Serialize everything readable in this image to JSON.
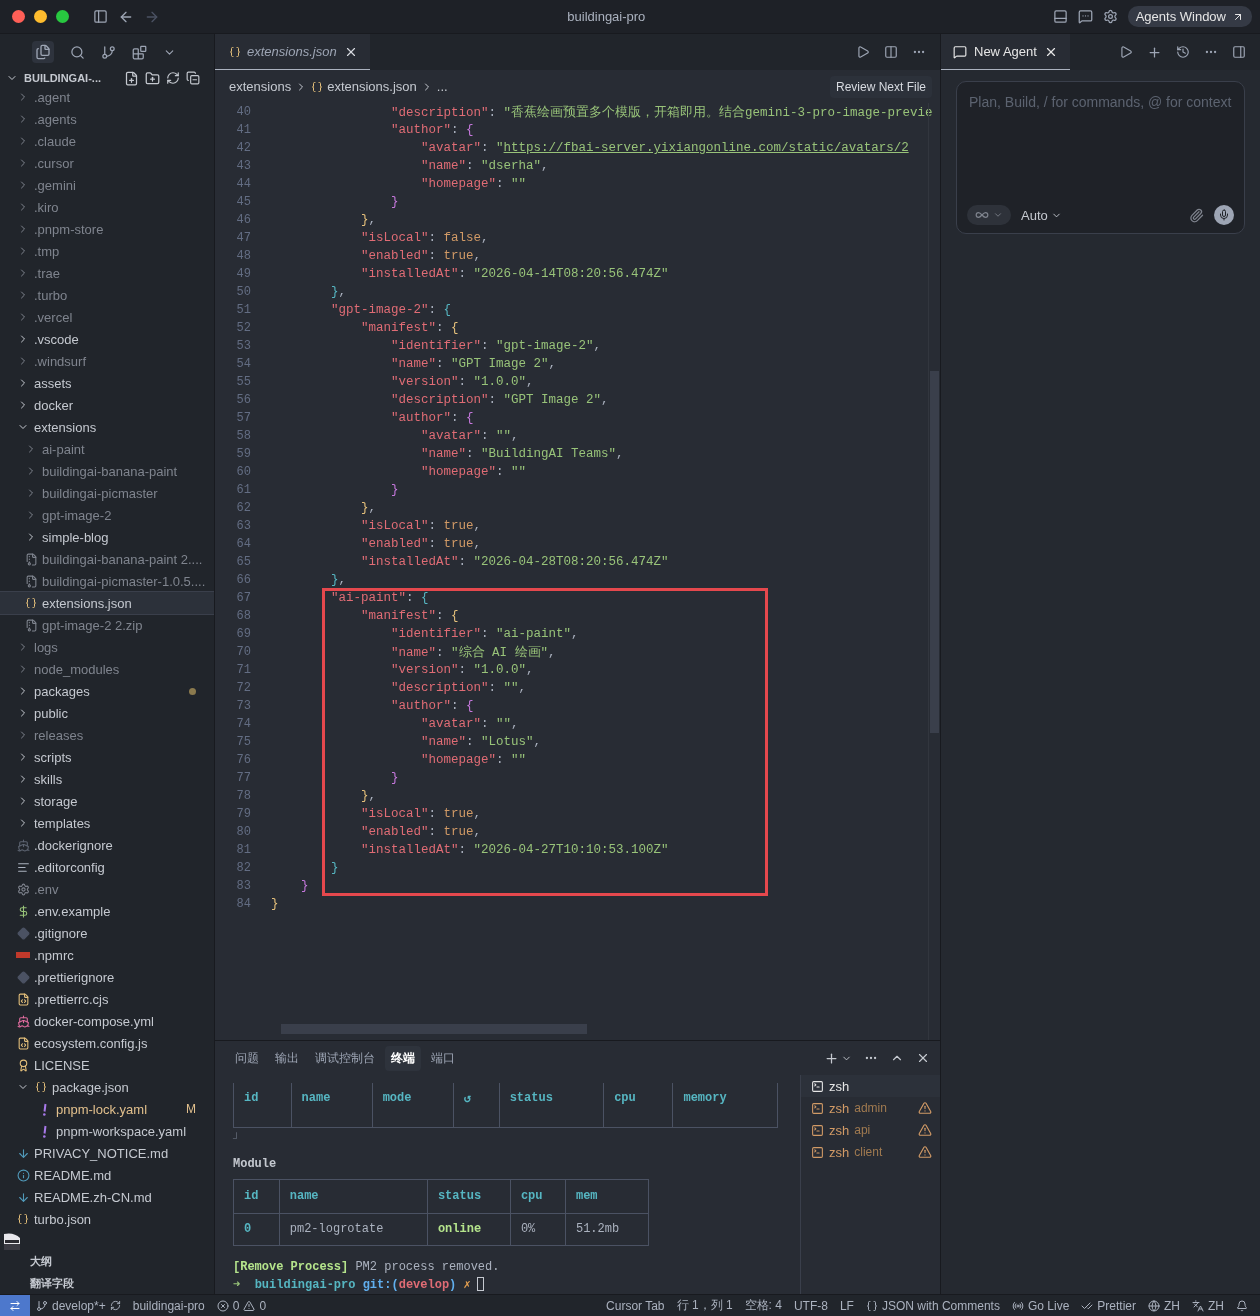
{
  "window": {
    "title": "buildingai-pro",
    "agents_button": "Agents Window"
  },
  "explorer": {
    "title": "BUILDINGAI-...",
    "tree": [
      {
        "name": ".agent",
        "kind": "folder",
        "expanded": false,
        "selected": false,
        "dimmed": true,
        "modified": false
      },
      {
        "name": ".agents",
        "kind": "folder",
        "expanded": false,
        "selected": false,
        "dimmed": true,
        "modified": false
      },
      {
        "name": ".claude",
        "kind": "folder",
        "expanded": false,
        "selected": false,
        "dimmed": true,
        "modified": false
      },
      {
        "name": ".cursor",
        "kind": "folder",
        "expanded": false,
        "selected": false,
        "dimmed": true,
        "modified": false
      },
      {
        "name": ".gemini",
        "kind": "folder",
        "expanded": false,
        "selected": false,
        "dimmed": true,
        "modified": false
      },
      {
        "name": ".kiro",
        "kind": "folder",
        "expanded": false,
        "selected": false,
        "dimmed": true,
        "modified": false
      },
      {
        "name": ".pnpm-store",
        "kind": "folder",
        "expanded": false,
        "selected": false,
        "dimmed": true,
        "modified": false
      },
      {
        "name": ".tmp",
        "kind": "folder",
        "expanded": false,
        "selected": false,
        "dimmed": true,
        "modified": false
      },
      {
        "name": ".trae",
        "kind": "folder",
        "expanded": false,
        "selected": false,
        "dimmed": true,
        "modified": false
      },
      {
        "name": ".turbo",
        "kind": "folder",
        "expanded": false,
        "selected": false,
        "dimmed": true,
        "modified": false
      },
      {
        "name": ".vercel",
        "kind": "folder",
        "expanded": false,
        "selected": false,
        "dimmed": true,
        "modified": false
      },
      {
        "name": ".vscode",
        "kind": "folder",
        "expanded": false,
        "selected": false,
        "dimmed": false,
        "modified": false
      },
      {
        "name": ".windsurf",
        "kind": "folder",
        "expanded": false,
        "selected": false,
        "dimmed": true,
        "modified": false
      },
      {
        "name": "assets",
        "kind": "folder",
        "expanded": false,
        "selected": false,
        "dimmed": false,
        "modified": false
      },
      {
        "name": "docker",
        "kind": "folder",
        "expanded": false,
        "selected": false,
        "dimmed": false,
        "modified": false
      },
      {
        "name": "extensions",
        "kind": "folder",
        "expanded": true,
        "selected": false,
        "dimmed": false,
        "modified": false,
        "children": [
          {
            "name": "ai-paint",
            "kind": "folder",
            "expanded": false,
            "selected": false,
            "dimmed": true,
            "modified": false
          },
          {
            "name": "buildingai-banana-paint",
            "kind": "folder",
            "expanded": false,
            "selected": false,
            "dimmed": true,
            "modified": false
          },
          {
            "name": "buildingai-picmaster",
            "kind": "folder",
            "expanded": false,
            "selected": false,
            "dimmed": true,
            "modified": false
          },
          {
            "name": "gpt-image-2",
            "kind": "folder",
            "expanded": false,
            "selected": false,
            "dimmed": true,
            "modified": false
          },
          {
            "name": "simple-blog",
            "kind": "folder",
            "expanded": false,
            "selected": false,
            "dimmed": false,
            "modified": false
          },
          {
            "name": "buildingai-banana-paint 2....",
            "kind": "zip",
            "selected": false,
            "dimmed": true,
            "modified": false
          },
          {
            "name": "buildingai-picmaster-1.0.5....",
            "kind": "zip",
            "selected": false,
            "dimmed": true,
            "modified": false
          },
          {
            "name": "extensions.json",
            "kind": "json",
            "selected": true,
            "dimmed": false,
            "modified": false
          },
          {
            "name": "gpt-image-2 2.zip",
            "kind": "zip",
            "selected": false,
            "dimmed": true,
            "modified": false
          }
        ]
      },
      {
        "name": "logs",
        "kind": "folder",
        "expanded": false,
        "selected": false,
        "dimmed": true,
        "modified": false
      },
      {
        "name": "node_modules",
        "kind": "folder",
        "expanded": false,
        "selected": false,
        "dimmed": true,
        "modified": false
      },
      {
        "name": "packages",
        "kind": "folder",
        "expanded": false,
        "selected": false,
        "dimmed": false,
        "modified": true
      },
      {
        "name": "public",
        "kind": "folder",
        "expanded": false,
        "selected": false,
        "dimmed": false,
        "modified": false
      },
      {
        "name": "releases",
        "kind": "folder",
        "expanded": false,
        "selected": false,
        "dimmed": true,
        "modified": false
      },
      {
        "name": "scripts",
        "kind": "folder",
        "expanded": false,
        "selected": false,
        "dimmed": false,
        "modified": false
      },
      {
        "name": "skills",
        "kind": "folder",
        "expanded": false,
        "selected": false,
        "dimmed": false,
        "modified": false
      },
      {
        "name": "storage",
        "kind": "folder",
        "expanded": false,
        "selected": false,
        "dimmed": false,
        "modified": false
      },
      {
        "name": "templates",
        "kind": "folder",
        "expanded": false,
        "selected": false,
        "dimmed": false,
        "modified": false
      },
      {
        "name": ".dockerignore",
        "kind": "docker",
        "selected": false,
        "dimmed": false,
        "modified": false
      },
      {
        "name": ".editorconfig",
        "kind": "lines",
        "selected": false,
        "dimmed": false,
        "modified": false
      },
      {
        "name": ".env",
        "kind": "gear",
        "selected": false,
        "dimmed": true,
        "modified": false
      },
      {
        "name": ".env.example",
        "kind": "dollar",
        "selected": false,
        "dimmed": false,
        "modified": false
      },
      {
        "name": ".gitignore",
        "kind": "git",
        "selected": false,
        "dimmed": false,
        "modified": false
      },
      {
        "name": ".npmrc",
        "kind": "npm",
        "selected": false,
        "dimmed": false,
        "modified": false
      },
      {
        "name": ".prettierignore",
        "kind": "git",
        "selected": false,
        "dimmed": false,
        "modified": false
      },
      {
        "name": ".prettierrc.cjs",
        "kind": "js",
        "selected": false,
        "dimmed": false,
        "modified": false
      },
      {
        "name": "docker-compose.yml",
        "kind": "whale",
        "selected": false,
        "dimmed": false,
        "modified": false
      },
      {
        "name": "ecosystem.config.js",
        "kind": "js",
        "selected": false,
        "dimmed": false,
        "modified": false
      },
      {
        "name": "LICENSE",
        "kind": "license",
        "selected": false,
        "dimmed": false,
        "modified": false
      },
      {
        "name": "package.json",
        "kind": "json",
        "expanded": true,
        "selected": false,
        "dimmed": false,
        "modified": false,
        "children": [
          {
            "name": "pnpm-lock.yaml",
            "kind": "yaml",
            "selected": false,
            "dimmed": false,
            "modified": true,
            "badge": "M"
          },
          {
            "name": "pnpm-workspace.yaml",
            "kind": "yaml",
            "selected": false,
            "dimmed": false,
            "modified": false
          }
        ]
      },
      {
        "name": "PRIVACY_NOTICE.md",
        "kind": "markdown",
        "selected": false,
        "dimmed": false,
        "modified": false
      },
      {
        "name": "README.md",
        "kind": "info",
        "selected": false,
        "dimmed": false,
        "modified": false
      },
      {
        "name": "README.zh-CN.md",
        "kind": "markdown",
        "selected": false,
        "dimmed": false,
        "modified": false
      },
      {
        "name": "turbo.json",
        "kind": "json",
        "selected": false,
        "dimmed": false,
        "modified": false
      }
    ],
    "sections": [
      "大纲",
      "翻译字段"
    ]
  },
  "editor": {
    "tab": {
      "label": "extensions.json",
      "preview": true
    },
    "breadcrumb": [
      "extensions",
      "extensions.json",
      "..."
    ],
    "review_button": "Review Next File",
    "lines": [
      {
        "no": "40",
        "tokens": [
          {
            "kind": "key",
            "text": "                \"description\""
          },
          {
            "kind": "punct",
            "text": ": "
          },
          {
            "kind": "str",
            "text": "\"香蕉绘画预置多个模版，开箱即用。结合gemini-3-pro-image-previe"
          }
        ]
      },
      {
        "no": "41",
        "tokens": [
          {
            "kind": "key",
            "text": "                \"author\""
          },
          {
            "kind": "punct",
            "text": ": "
          },
          {
            "kind": "brace",
            "text": "{",
            "color": "#c678dd"
          }
        ]
      },
      {
        "no": "42",
        "tokens": [
          {
            "kind": "key",
            "text": "                    \"avatar\""
          },
          {
            "kind": "punct",
            "text": ": "
          },
          {
            "kind": "str",
            "text": "\""
          },
          {
            "kind": "link",
            "text": "https://fbai-server.yixiangonline.com/static/avatars/2"
          }
        ]
      },
      {
        "no": "43",
        "tokens": [
          {
            "kind": "key",
            "text": "                    \"name\""
          },
          {
            "kind": "punct",
            "text": ": "
          },
          {
            "kind": "str",
            "text": "\"dserha\""
          },
          {
            "kind": "punct",
            "text": ","
          }
        ]
      },
      {
        "no": "44",
        "tokens": [
          {
            "kind": "key",
            "text": "                    \"homepage\""
          },
          {
            "kind": "punct",
            "text": ": "
          },
          {
            "kind": "str",
            "text": "\"\""
          }
        ]
      },
      {
        "no": "45",
        "tokens": [
          {
            "kind": "brace",
            "text": "                }",
            "color": "#c678dd"
          }
        ]
      },
      {
        "no": "46",
        "tokens": [
          {
            "kind": "brace",
            "text": "            }",
            "color": "#e5c07b"
          },
          {
            "kind": "punct",
            "text": ","
          }
        ]
      },
      {
        "no": "47",
        "tokens": [
          {
            "kind": "key",
            "text": "            \"isLocal\""
          },
          {
            "kind": "punct",
            "text": ": "
          },
          {
            "kind": "bool",
            "text": "false"
          },
          {
            "kind": "punct",
            "text": ","
          }
        ]
      },
      {
        "no": "48",
        "tokens": [
          {
            "kind": "key",
            "text": "            \"enabled\""
          },
          {
            "kind": "punct",
            "text": ": "
          },
          {
            "kind": "bool",
            "text": "true"
          },
          {
            "kind": "punct",
            "text": ","
          }
        ]
      },
      {
        "no": "49",
        "tokens": [
          {
            "kind": "key",
            "text": "            \"installedAt\""
          },
          {
            "kind": "punct",
            "text": ": "
          },
          {
            "kind": "str",
            "text": "\"2026-04-14T08:20:56.474Z\""
          }
        ]
      },
      {
        "no": "50",
        "tokens": [
          {
            "kind": "brace",
            "text": "        }",
            "color": "#56b6c2"
          },
          {
            "kind": "punct",
            "text": ","
          }
        ]
      },
      {
        "no": "51",
        "tokens": [
          {
            "kind": "key",
            "text": "        \"gpt-image-2\""
          },
          {
            "kind": "punct",
            "text": ": "
          },
          {
            "kind": "brace",
            "text": "{",
            "color": "#56b6c2"
          }
        ]
      },
      {
        "no": "52",
        "tokens": [
          {
            "kind": "key",
            "text": "            \"manifest\""
          },
          {
            "kind": "punct",
            "text": ": "
          },
          {
            "kind": "brace",
            "text": "{",
            "color": "#e5c07b"
          }
        ]
      },
      {
        "no": "53",
        "tokens": [
          {
            "kind": "key",
            "text": "                \"identifier\""
          },
          {
            "kind": "punct",
            "text": ": "
          },
          {
            "kind": "str",
            "text": "\"gpt-image-2\""
          },
          {
            "kind": "punct",
            "text": ","
          }
        ]
      },
      {
        "no": "54",
        "tokens": [
          {
            "kind": "key",
            "text": "                \"name\""
          },
          {
            "kind": "punct",
            "text": ": "
          },
          {
            "kind": "str",
            "text": "\"GPT Image 2\""
          },
          {
            "kind": "punct",
            "text": ","
          }
        ]
      },
      {
        "no": "55",
        "tokens": [
          {
            "kind": "key",
            "text": "                \"version\""
          },
          {
            "kind": "punct",
            "text": ": "
          },
          {
            "kind": "str",
            "text": "\"1.0.0\""
          },
          {
            "kind": "punct",
            "text": ","
          }
        ]
      },
      {
        "no": "56",
        "tokens": [
          {
            "kind": "key",
            "text": "                \"description\""
          },
          {
            "kind": "punct",
            "text": ": "
          },
          {
            "kind": "str",
            "text": "\"GPT Image 2\""
          },
          {
            "kind": "punct",
            "text": ","
          }
        ]
      },
      {
        "no": "57",
        "tokens": [
          {
            "kind": "key",
            "text": "                \"author\""
          },
          {
            "kind": "punct",
            "text": ": "
          },
          {
            "kind": "brace",
            "text": "{",
            "color": "#c678dd"
          }
        ]
      },
      {
        "no": "58",
        "tokens": [
          {
            "kind": "key",
            "text": "                    \"avatar\""
          },
          {
            "kind": "punct",
            "text": ": "
          },
          {
            "kind": "str",
            "text": "\"\""
          },
          {
            "kind": "punct",
            "text": ","
          }
        ]
      },
      {
        "no": "59",
        "tokens": [
          {
            "kind": "key",
            "text": "                    \"name\""
          },
          {
            "kind": "punct",
            "text": ": "
          },
          {
            "kind": "str",
            "text": "\"BuildingAI Teams\""
          },
          {
            "kind": "punct",
            "text": ","
          }
        ]
      },
      {
        "no": "60",
        "tokens": [
          {
            "kind": "key",
            "text": "                    \"homepage\""
          },
          {
            "kind": "punct",
            "text": ": "
          },
          {
            "kind": "str",
            "text": "\"\""
          }
        ]
      },
      {
        "no": "61",
        "tokens": [
          {
            "kind": "brace",
            "text": "                }",
            "color": "#c678dd"
          }
        ]
      },
      {
        "no": "62",
        "tokens": [
          {
            "kind": "brace",
            "text": "            }",
            "color": "#e5c07b"
          },
          {
            "kind": "punct",
            "text": ","
          }
        ]
      },
      {
        "no": "63",
        "tokens": [
          {
            "kind": "key",
            "text": "            \"isLocal\""
          },
          {
            "kind": "punct",
            "text": ": "
          },
          {
            "kind": "bool",
            "text": "true"
          },
          {
            "kind": "punct",
            "text": ","
          }
        ]
      },
      {
        "no": "64",
        "tokens": [
          {
            "kind": "key",
            "text": "            \"enabled\""
          },
          {
            "kind": "punct",
            "text": ": "
          },
          {
            "kind": "bool",
            "text": "true"
          },
          {
            "kind": "punct",
            "text": ","
          }
        ]
      },
      {
        "no": "65",
        "tokens": [
          {
            "kind": "key",
            "text": "            \"installedAt\""
          },
          {
            "kind": "punct",
            "text": ": "
          },
          {
            "kind": "str",
            "text": "\"2026-04-28T08:20:56.474Z\""
          }
        ]
      },
      {
        "no": "66",
        "tokens": [
          {
            "kind": "brace",
            "text": "        }",
            "color": "#56b6c2"
          },
          {
            "kind": "punct",
            "text": ","
          }
        ]
      }
    ],
    "framed_lines": [
      {
        "no": "67",
        "tokens": [
          {
            "kind": "key",
            "text": "        \"ai-paint\""
          },
          {
            "kind": "punct",
            "text": ": "
          },
          {
            "kind": "brace",
            "text": "{",
            "color": "#56b6c2"
          }
        ]
      },
      {
        "no": "68",
        "tokens": [
          {
            "kind": "key",
            "text": "            \"manifest\""
          },
          {
            "kind": "punct",
            "text": ": "
          },
          {
            "kind": "brace",
            "text": "{",
            "color": "#e5c07b"
          }
        ]
      },
      {
        "no": "69",
        "tokens": [
          {
            "kind": "key",
            "text": "                \"identifier\""
          },
          {
            "kind": "punct",
            "text": ": "
          },
          {
            "kind": "str",
            "text": "\"ai-paint\""
          },
          {
            "kind": "punct",
            "text": ","
          }
        ]
      },
      {
        "no": "70",
        "tokens": [
          {
            "kind": "key",
            "text": "                \"name\""
          },
          {
            "kind": "punct",
            "text": ": "
          },
          {
            "kind": "str",
            "text": "\"综合 AI 绘画\""
          },
          {
            "kind": "punct",
            "text": ","
          }
        ]
      },
      {
        "no": "71",
        "tokens": [
          {
            "kind": "key",
            "text": "                \"version\""
          },
          {
            "kind": "punct",
            "text": ": "
          },
          {
            "kind": "str",
            "text": "\"1.0.0\""
          },
          {
            "kind": "punct",
            "text": ","
          }
        ]
      },
      {
        "no": "72",
        "tokens": [
          {
            "kind": "key",
            "text": "                \"description\""
          },
          {
            "kind": "punct",
            "text": ": "
          },
          {
            "kind": "str",
            "text": "\"\""
          },
          {
            "kind": "punct",
            "text": ","
          }
        ]
      },
      {
        "no": "73",
        "tokens": [
          {
            "kind": "key",
            "text": "                \"author\""
          },
          {
            "kind": "punct",
            "text": ": "
          },
          {
            "kind": "brace",
            "text": "{",
            "color": "#c678dd"
          }
        ]
      },
      {
        "no": "74",
        "tokens": [
          {
            "kind": "key",
            "text": "                    \"avatar\""
          },
          {
            "kind": "punct",
            "text": ": "
          },
          {
            "kind": "str",
            "text": "\"\""
          },
          {
            "kind": "punct",
            "text": ","
          }
        ]
      },
      {
        "no": "75",
        "tokens": [
          {
            "kind": "key",
            "text": "                    \"name\""
          },
          {
            "kind": "punct",
            "text": ": "
          },
          {
            "kind": "str",
            "text": "\"Lotus\""
          },
          {
            "kind": "punct",
            "text": ","
          }
        ]
      },
      {
        "no": "76",
        "tokens": [
          {
            "kind": "key",
            "text": "                    \"homepage\""
          },
          {
            "kind": "punct",
            "text": ": "
          },
          {
            "kind": "str",
            "text": "\"\""
          }
        ]
      },
      {
        "no": "77",
        "tokens": [
          {
            "kind": "brace",
            "text": "                }",
            "color": "#c678dd"
          }
        ]
      },
      {
        "no": "78",
        "tokens": [
          {
            "kind": "brace",
            "text": "            }",
            "color": "#e5c07b"
          },
          {
            "kind": "punct",
            "text": ","
          }
        ]
      },
      {
        "no": "79",
        "tokens": [
          {
            "kind": "key",
            "text": "            \"isLocal\""
          },
          {
            "kind": "punct",
            "text": ": "
          },
          {
            "kind": "bool",
            "text": "true"
          },
          {
            "kind": "punct",
            "text": ","
          }
        ]
      },
      {
        "no": "80",
        "tokens": [
          {
            "kind": "key",
            "text": "            \"enabled\""
          },
          {
            "kind": "punct",
            "text": ": "
          },
          {
            "kind": "bool",
            "text": "true"
          },
          {
            "kind": "punct",
            "text": ","
          }
        ]
      },
      {
        "no": "81",
        "tokens": [
          {
            "kind": "key",
            "text": "            \"installedAt\""
          },
          {
            "kind": "punct",
            "text": ": "
          },
          {
            "kind": "str",
            "text": "\"2026-04-27T10:10:53.100Z\""
          }
        ]
      },
      {
        "no": "82",
        "tokens": [
          {
            "kind": "brace",
            "text": "        }",
            "color": "#56b6c2"
          }
        ]
      },
      {
        "no": "83",
        "tokens": [
          {
            "kind": "brace",
            "text": "    }",
            "color": "#c678dd"
          }
        ]
      }
    ],
    "lines_after": [
      {
        "no": "84",
        "tokens": [
          {
            "kind": "brace",
            "text": "}",
            "color": "#e5c07b"
          }
        ]
      }
    ]
  },
  "panel": {
    "tabs": [
      {
        "label": "问题",
        "selected": false
      },
      {
        "label": "输出",
        "selected": false
      },
      {
        "label": "调试控制台",
        "selected": false
      },
      {
        "label": "终端",
        "selected": true
      },
      {
        "label": "端口",
        "selected": false
      }
    ],
    "terminal": {
      "pm2_columns": [
        "id",
        "name",
        "mode",
        "↺",
        "status",
        "cpu",
        "memory"
      ],
      "corner": "┘",
      "module_title": "Module",
      "module_table": {
        "columns": [
          "id",
          "name",
          "status",
          "cpu",
          "mem"
        ],
        "rows": [
          [
            "0",
            "pm2-logrotate",
            "online",
            "0%",
            "51.2mb"
          ]
        ]
      },
      "log": {
        "tag": "[Remove Process]",
        "message": "PM2 process removed."
      },
      "prompt": {
        "arrow": "➜",
        "dir": "buildingai-pro",
        "git_open": "git:(",
        "branch": "develop",
        "git_close": ")",
        "dirty": "✗"
      }
    },
    "terminals": [
      {
        "name": "zsh",
        "selected": true,
        "warning": false
      },
      {
        "name": "zsh",
        "detail": "admin",
        "selected": false,
        "warning": true
      },
      {
        "name": "zsh",
        "detail": "api",
        "selected": false,
        "warning": true
      },
      {
        "name": "zsh",
        "detail": "client",
        "selected": false,
        "warning": true
      }
    ]
  },
  "agent": {
    "tab": "New Agent",
    "placeholder": "Plan, Build, / for commands, @ for context",
    "mode": "Auto"
  },
  "status_bar": {
    "branch": "develop*+",
    "project": "buildingai-pro",
    "errors": "0",
    "warnings": "0",
    "items": [
      {
        "kind": "text",
        "label": "Cursor Tab"
      },
      {
        "kind": "text",
        "label": "行 1，列 1"
      },
      {
        "kind": "text",
        "label": "空格: 4"
      },
      {
        "kind": "text",
        "label": "UTF-8"
      },
      {
        "kind": "text",
        "label": "LF"
      },
      {
        "kind": "language",
        "label": "JSON with Comments"
      },
      {
        "kind": "live",
        "label": "Go Live"
      },
      {
        "kind": "prettier",
        "label": "Prettier"
      },
      {
        "kind": "globe",
        "label": "ZH"
      },
      {
        "kind": "translate",
        "label": "ZH"
      },
      {
        "kind": "bell"
      }
    ]
  }
}
